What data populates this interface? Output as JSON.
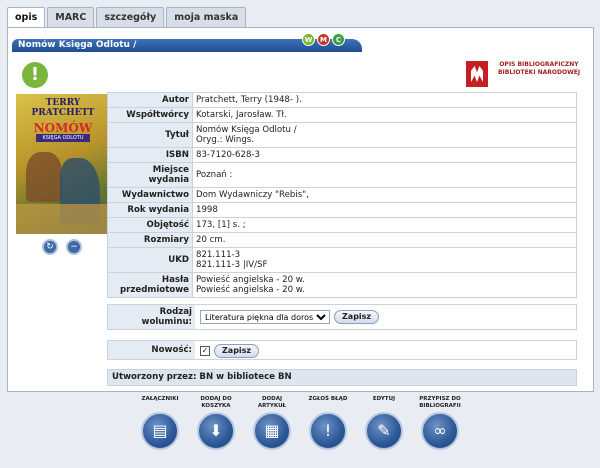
{
  "tabs": [
    {
      "label": "opis",
      "active": true
    },
    {
      "label": "MARC",
      "active": false
    },
    {
      "label": "szczegóły",
      "active": false
    },
    {
      "label": "moja maska",
      "active": false
    }
  ],
  "titlebar": {
    "title": "Nomów Księga Odlotu /",
    "buttons": [
      "W",
      "M",
      "C"
    ]
  },
  "logo": {
    "text": "OPIS BIBLIOGRAFICZNY BIBLIOTEKI NARODOWEJ"
  },
  "cover": {
    "author": "TERRY PRATCHETT",
    "title": "NOMÓW",
    "subtitle": "KSIĘGA ODLOTU"
  },
  "record": [
    {
      "key": "Autor",
      "value": "Pratchett, Terry (1948- )."
    },
    {
      "key": "Współtwórcy",
      "value": "Kotarski, Jarosław. Tł."
    },
    {
      "key": "Tytuł",
      "value": "Nomów Księga Odlotu /\nOryg.: Wings."
    },
    {
      "key": "ISBN",
      "value": "83-7120-628-3"
    },
    {
      "key": "Miejsce wydania",
      "value": "Poznań :"
    },
    {
      "key": "Wydawnictwo",
      "value": "Dom Wydawniczy \"Rebis\","
    },
    {
      "key": "Rok wydania",
      "value": "1998"
    },
    {
      "key": "Objętość",
      "value": "173, [1] s. ;"
    },
    {
      "key": "Rozmiary",
      "value": "20 cm."
    },
    {
      "key": "UKD",
      "value": "821.111-3\n821.111-3 |IV/SF"
    },
    {
      "key": "Hasła przedmiotowe",
      "value": "Powieść angielska - 20 w.\nPowieść angielska - 20 w."
    }
  ],
  "rodzaj": {
    "label": "Rodzaj woluminu:",
    "selected": "Literatura piękna dla dorosłych",
    "save": "Zapisz"
  },
  "nowosc": {
    "label": "Nowość:",
    "checked": true,
    "save": "Zapisz"
  },
  "created": "Utworzony przez: BN w bibliotece BN",
  "actions": [
    {
      "label": "ZAŁĄCZNIKI",
      "icon": "attachments-icon",
      "glyph": "▤"
    },
    {
      "label": "DODAJ DO KOSZYKA",
      "icon": "basket-icon",
      "glyph": "⬇"
    },
    {
      "label": "DODAJ ARTYKUŁ",
      "icon": "article-icon",
      "glyph": "▦"
    },
    {
      "label": "ZGŁOŚ BŁĄD",
      "icon": "warning-icon",
      "glyph": "!"
    },
    {
      "label": "EDYTUJ",
      "icon": "edit-icon",
      "glyph": "✎"
    },
    {
      "label": "PRZYPISZ DO BIBLIOGRAFII",
      "icon": "link-icon",
      "glyph": "∞"
    }
  ]
}
